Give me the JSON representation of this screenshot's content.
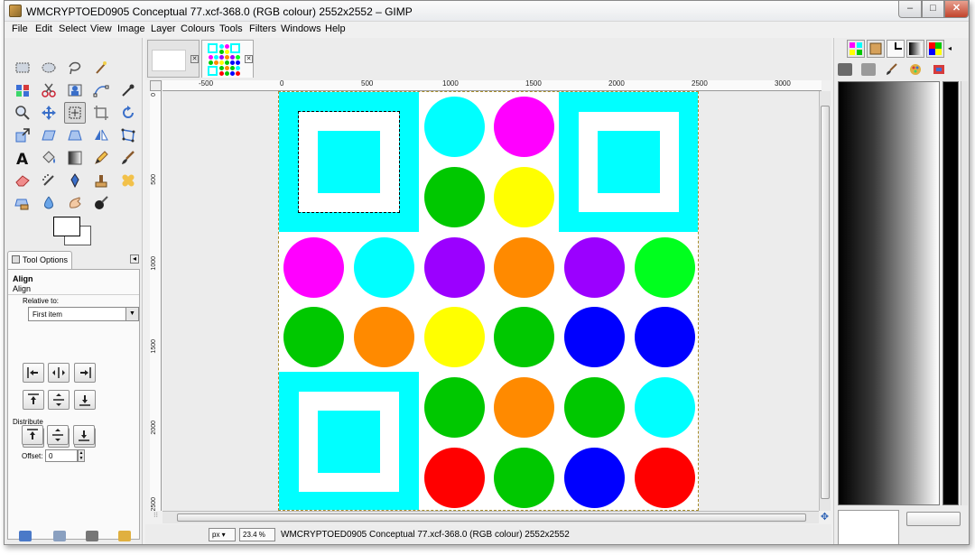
{
  "window": {
    "title": "WMCRYPTOED0905 Conceptual 77.xcf-368.0 (RGB colour) 2552x2552 – GIMP",
    "minimize": "–",
    "maximize": "□",
    "close": "✕"
  },
  "menu": [
    "File",
    "Edit",
    "Select",
    "View",
    "Image",
    "Layer",
    "Colours",
    "Tools",
    "Filters",
    "Windows",
    "Help"
  ],
  "toolbox": {
    "tools": [
      "rect-select",
      "ellipse-select",
      "free-select",
      "fuzzy-select",
      "by-colour-select",
      "scissors-select",
      "foreground-select",
      "paths",
      "colour-picker",
      "zoom",
      "measure",
      "move",
      "align",
      "crop",
      "rotate",
      "scale",
      "shear",
      "perspective",
      "flip",
      "cage-transform",
      "text",
      "bucket-fill",
      "blend",
      "pencil",
      "paintbrush",
      "eraser",
      "airbrush",
      "ink",
      "clone",
      "heal",
      "perspective-clone",
      "blur",
      "smudge",
      "dodge-burn"
    ],
    "active_tool": "align"
  },
  "tool_options": {
    "tab_label": "Tool Options",
    "heading": "Align",
    "subheading": "Align",
    "relative_to_label": "Relative to:",
    "relative_to_value": "First item",
    "distribute_label": "Distribute",
    "offset_label": "Offset:",
    "offset_value": "0"
  },
  "image_tabs": [
    {
      "name": "blank-image",
      "close": "✕"
    },
    {
      "name": "conceptual-77",
      "close": "✕",
      "active": true
    }
  ],
  "ruler": {
    "h_labels": [
      "-500",
      "0",
      "500",
      "1000",
      "1500",
      "2000",
      "2500",
      "3000"
    ],
    "v_labels": [
      "0",
      "500",
      "1000",
      "1500",
      "2000",
      "2500"
    ]
  },
  "canvas": {
    "background": "#ffffff",
    "colors": {
      "cyan": "#00ffff",
      "magenta": "#ff00ff",
      "green": "#00c800",
      "yellow": "#ffff00",
      "purple": "#9b00ff",
      "orange": "#ff8a00",
      "lime": "#00ff1e",
      "blue": "#0000ff",
      "red": "#ff0000"
    },
    "squares": [
      "top-left",
      "top-right",
      "bottom-left"
    ],
    "circles": [
      [
        "",
        "",
        "cyan",
        "magenta",
        "",
        ""
      ],
      [
        "",
        "",
        "green",
        "yellow",
        "",
        ""
      ],
      [
        "magenta",
        "cyan",
        "purple",
        "orange",
        "purple",
        "lime"
      ],
      [
        "green",
        "orange",
        "yellow",
        "green",
        "blue",
        "blue"
      ],
      [
        "",
        "",
        "green",
        "orange",
        "green",
        "cyan"
      ],
      [
        "",
        "",
        "red",
        "green",
        "blue",
        "red"
      ]
    ]
  },
  "statusbar": {
    "unit": "px",
    "zoom": "23.4 %",
    "text": "WMCRYPTOED0905 Conceptual 77.xcf-368.0 (RGB colour) 2552x2552"
  },
  "dock": {
    "tabs": [
      "palettes",
      "fonts",
      "brushes",
      "gradients",
      "colours"
    ],
    "row2": [
      "tool-presets",
      "printer",
      "paintbrush",
      "palette",
      "patterns"
    ]
  }
}
